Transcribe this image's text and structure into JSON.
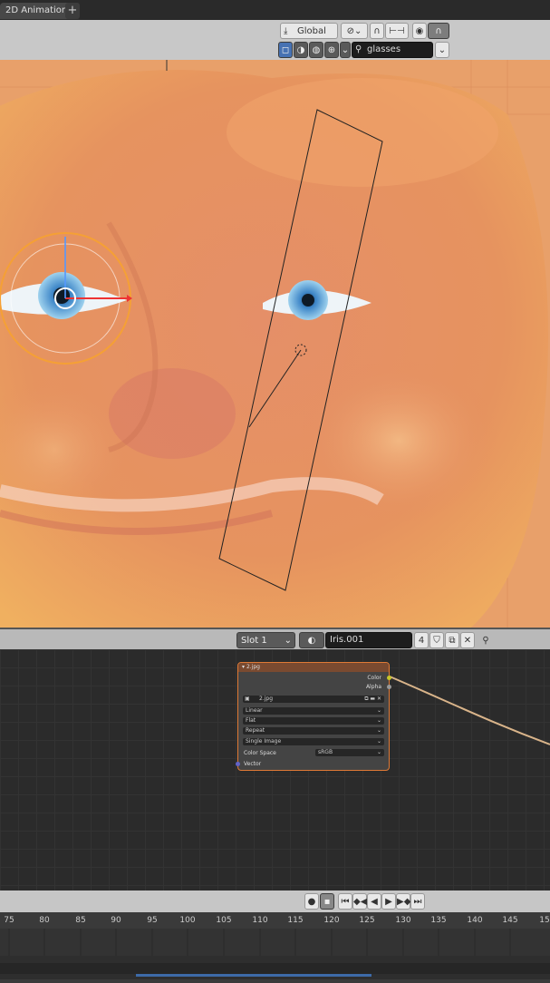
{
  "workspace_tab": "2D Animation",
  "add_tab": "+",
  "viewport_header": {
    "transform_orientation": "Global",
    "chevron": "⌄",
    "search_value": "glasses"
  },
  "node_editor_header": {
    "slot": "Slot 1",
    "material_name": "Iris.001",
    "user_count": "4"
  },
  "image_node": {
    "title": "2.jpg",
    "outputs": [
      "Color",
      "Alpha"
    ],
    "image_name": "2.jpg",
    "interpolation": "Linear",
    "projection": "Flat",
    "extension": "Repeat",
    "source": "Single Image",
    "color_space_label": "Color Space",
    "color_space_value": "sRGB",
    "input_vector": "Vector",
    "colors": {
      "header": "#7a4a30",
      "border": "#e07a36",
      "color_socket": "#c7c729",
      "vector_socket": "#6363c7"
    }
  },
  "timeline": {
    "frames": [
      "75",
      "80",
      "85",
      "90",
      "95",
      "100",
      "105",
      "110",
      "115",
      "120",
      "125",
      "130",
      "135",
      "140",
      "145",
      "15"
    ]
  },
  "colors": {
    "skin": "#e89a62",
    "iris": "#4a8fd0",
    "selection": "#f5a035",
    "panel_light": "#c8c8c8",
    "editor_bg": "#2b2b2b"
  }
}
